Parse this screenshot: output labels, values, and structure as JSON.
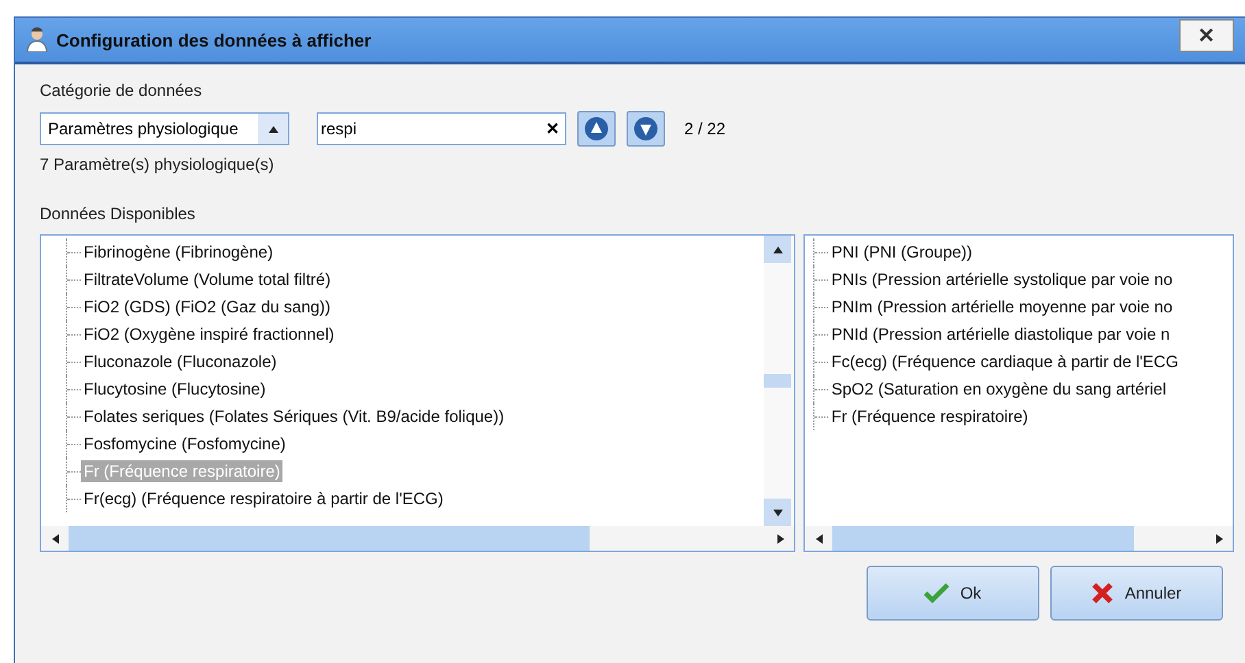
{
  "window": {
    "title": "Configuration des données à afficher",
    "close": "✕"
  },
  "category": {
    "label": "Catégorie de données",
    "value": "Paramètres physiologique",
    "count_text": "7 Paramètre(s) physiologique(s)"
  },
  "search": {
    "value": "respi",
    "clear": "✕",
    "match": "2 / 22"
  },
  "available": {
    "label": "Données Disponibles",
    "items": [
      {
        "text": "Fibrinogène (Fibrinogène)",
        "selected": false
      },
      {
        "text": "FiltrateVolume (Volume total filtré)",
        "selected": false
      },
      {
        "text": "FiO2 (GDS) (FiO2 (Gaz du sang))",
        "selected": false
      },
      {
        "text": "FiO2 (Oxygène inspiré fractionnel)",
        "selected": false
      },
      {
        "text": "Fluconazole (Fluconazole)",
        "selected": false
      },
      {
        "text": "Flucytosine (Flucytosine)",
        "selected": false
      },
      {
        "text": "Folates seriques (Folates Sériques (Vit. B9/acide folique))",
        "selected": false
      },
      {
        "text": "Fosfomycine (Fosfomycine)",
        "selected": false
      },
      {
        "text": "Fr (Fréquence respiratoire)",
        "selected": true
      },
      {
        "text": "Fr(ecg) (Fréquence respiratoire à partir de l'ECG)",
        "selected": false
      }
    ]
  },
  "chosen": {
    "items": [
      "PNI (PNI (Groupe))",
      "PNIs (Pression artérielle systolique par voie no",
      "PNIm (Pression artérielle moyenne par voie no",
      "PNId (Pression artérielle diastolique par voie n",
      "Fc(ecg) (Fréquence cardiaque à partir de l'ECG",
      "SpO2 (Saturation en oxygène du sang artériel",
      "Fr (Fréquence respiratoire)"
    ]
  },
  "buttons": [
    {
      "kind": "ok",
      "label": "Ok"
    },
    {
      "kind": "cancel",
      "label": "Annuler"
    }
  ]
}
